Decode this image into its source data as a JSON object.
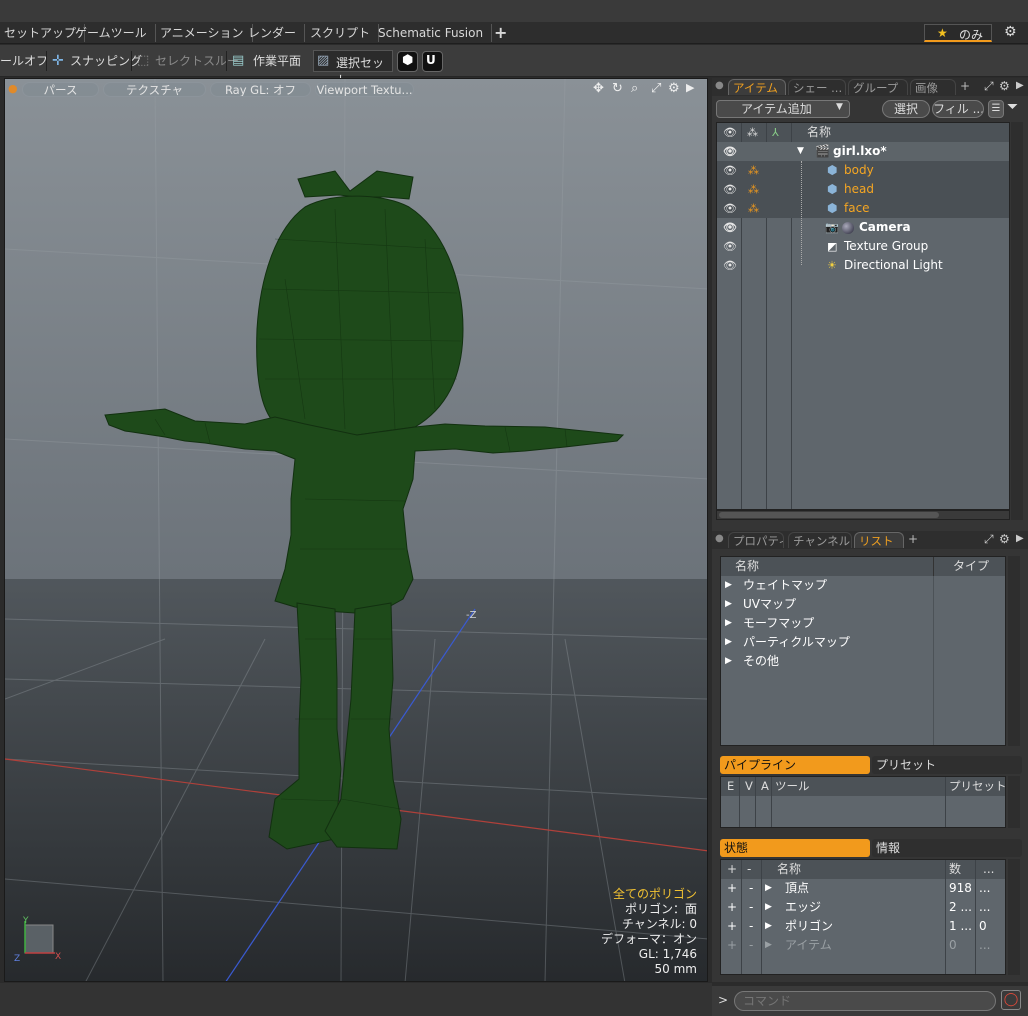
{
  "menu_tabs": [
    "セットアップ",
    "ゲームツール",
    "アニメーション",
    "レンダー",
    "スクリプト",
    "Schematic Fusion"
  ],
  "add_tab_label": "+",
  "layout_label": "のみ",
  "toolbar": {
    "tool_off": "ールオフ",
    "snapping": "スナッピング",
    "select_through": "セレクトスルー",
    "work_plane": "作業平面",
    "selection_set": "選択セット"
  },
  "viewport": {
    "perspective": "パース",
    "texture": "テクスチャ",
    "raygl": "Ray GL: オフ",
    "vp_texture": "Viewport Textu...",
    "axis_label": "-Z",
    "info": {
      "all_polygons": "全てのポリゴン",
      "polygon": "ポリゴン：面",
      "channel": "チャンネル: 0",
      "deformer": "デフォーマ：オン",
      "gl": "GL: 1,746",
      "focal": "50 mm"
    }
  },
  "items_panel": {
    "tabs": [
      "アイテム",
      "シェー ...",
      "グループ",
      "画像"
    ],
    "add_item": "アイテム追加",
    "select": "選択",
    "filter": "フィル ...",
    "col_name": "名称",
    "scene": "girl.lxo*",
    "items": [
      {
        "name": "body",
        "type": "mesh",
        "selected": true
      },
      {
        "name": "head",
        "type": "mesh",
        "selected": true
      },
      {
        "name": "face",
        "type": "mesh",
        "selected": true
      },
      {
        "name": "Camera",
        "type": "camera",
        "selected": false
      },
      {
        "name": "Texture Group",
        "type": "texture-group",
        "selected": false
      },
      {
        "name": "Directional Light",
        "type": "light",
        "selected": false
      }
    ]
  },
  "list_panel": {
    "tabs": [
      "プロパティ",
      "チャンネル",
      "リスト"
    ],
    "col_name": "名称",
    "col_type": "タイプ",
    "rows": [
      "ウェイトマップ",
      "UVマップ",
      "モーフマップ",
      "パーティクルマップ",
      "その他"
    ]
  },
  "pipeline": {
    "tab1": "パイプライン",
    "tab2": "プリセット",
    "cols": [
      "E",
      "V",
      "A",
      "ツール",
      "プリセット"
    ]
  },
  "stats": {
    "tab1": "状態",
    "tab2": "情報",
    "col_name": "名称",
    "col_count": "数",
    "col_more": "...",
    "rows": [
      {
        "name": "頂点",
        "count": "918",
        "extra": "...",
        "dim": false
      },
      {
        "name": "エッジ",
        "count": "2 ...",
        "extra": "...",
        "dim": false
      },
      {
        "name": "ポリゴン",
        "count": "1 ...",
        "extra": "0",
        "dim": false
      },
      {
        "name": "アイテム",
        "count": "0",
        "extra": "...",
        "dim": true
      }
    ]
  },
  "command": {
    "prompt": ">",
    "placeholder": "コマンド"
  },
  "colors": {
    "accent": "#f29a1c",
    "selected_item_text": "#f5a623",
    "model_green": "#1e4a1a"
  }
}
